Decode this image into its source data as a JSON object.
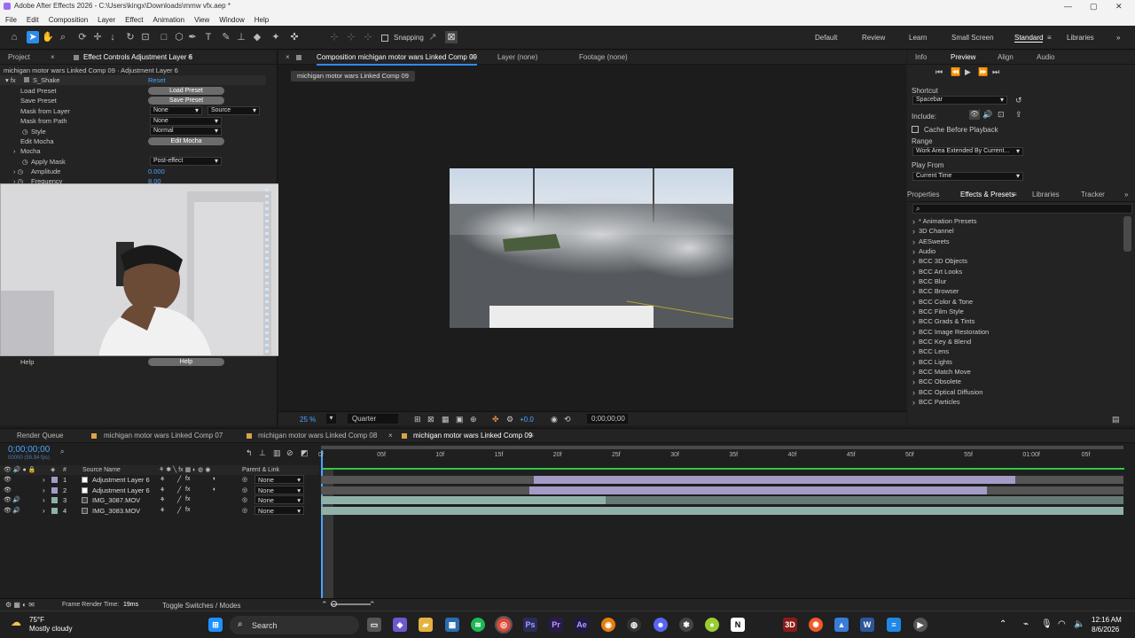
{
  "window": {
    "title": "Adobe After Effects 2026 - C:\\Users\\kingx\\Downloads\\mmw vfx.aep *"
  },
  "menu": [
    "File",
    "Edit",
    "Composition",
    "Layer",
    "Effect",
    "Animation",
    "View",
    "Window",
    "Help"
  ],
  "toolbar": {
    "snapping": "Snapping"
  },
  "workspaces": [
    "Default",
    "Review",
    "Learn",
    "Small Screen",
    "Standard",
    "Libraries"
  ],
  "left_panel": {
    "tabs": [
      "Project",
      "Effect Controls Adjustment Layer 6"
    ],
    "subtitle": "michigan motor wars Linked Comp 09 · Adjustment Layer 6",
    "effect_name": "S_Shake",
    "reset": "Reset",
    "props": [
      {
        "label": "Load Preset",
        "control": "Load Preset"
      },
      {
        "label": "Save Preset",
        "control": "Save Preset"
      },
      {
        "label": "Mask from Layer",
        "control": "None",
        "control2": "Source"
      },
      {
        "label": "Mask from Path",
        "control": "None"
      },
      {
        "label": "Style",
        "control": "Normal"
      },
      {
        "label": "Edit Mocha",
        "control": "Edit Mocha"
      },
      {
        "label": "Mocha",
        "control": ""
      },
      {
        "label": "Apply Mask",
        "control": "Post-effect"
      },
      {
        "label": "Amplitude",
        "control": "0.000"
      },
      {
        "label": "Frequency",
        "control": "8.00"
      }
    ],
    "help_label": "Help",
    "help_button": "Help"
  },
  "viewer": {
    "tabs": [
      "Composition michigan motor wars Linked Comp 09",
      "Layer (none)",
      "Footage (none)"
    ],
    "comp_chip": "michigan motor wars Linked Comp 09",
    "zoom": "25 %",
    "resolution": "Quarter",
    "exposure": "+0.0",
    "timecode": "0;00;00;00"
  },
  "preview_panel": {
    "tabs": [
      "Info",
      "Preview",
      "Align",
      "Audio"
    ],
    "shortcut_label": "Shortcut",
    "shortcut_value": "Spacebar",
    "include_label": "Include:",
    "cache_label": "Cache Before Playback",
    "range_label": "Range",
    "range_value": "Work Area Extended By Current...",
    "play_from_label": "Play From",
    "play_from_value": "Current Time"
  },
  "effects_panel": {
    "tabs": [
      "Properties",
      "Effects & Presets",
      "Libraries",
      "Tracker"
    ],
    "search_placeholder": "",
    "items": [
      "* Animation Presets",
      "3D Channel",
      "AESweets",
      "Audio",
      "BCC 3D Objects",
      "BCC Art Looks",
      "BCC Blur",
      "BCC Browser",
      "BCC Color & Tone",
      "BCC Film Style",
      "BCC Grads & Tints",
      "BCC Image Restoration",
      "BCC Key & Blend",
      "BCC Lens",
      "BCC Lights",
      "BCC Match Move",
      "BCC Obsolete",
      "BCC Optical Diffusion",
      "BCC Particles"
    ]
  },
  "timeline": {
    "tabs": [
      "Render Queue",
      "michigan motor wars Linked Comp 07",
      "michigan motor wars Linked Comp 08",
      "michigan motor wars Linked Comp 09"
    ],
    "timecode": "0;00;00;00",
    "timecode_sub": "00000 (59.94 fps)",
    "col_num": "#",
    "col_source": "Source Name",
    "col_parent": "Parent & Link",
    "layers": [
      {
        "num": "1",
        "name": "Adjustment Layer 6",
        "parent": "None",
        "color": "#a49bc7",
        "start": 0.265,
        "end": 0.865
      },
      {
        "num": "2",
        "name": "Adjustment Layer 6",
        "parent": "None",
        "color": "#a49bc7",
        "start": 0.26,
        "end": 0.83
      },
      {
        "num": "3",
        "name": "IMG_3087.MOV",
        "parent": "None",
        "color": "#8fb1a9",
        "start": 0.0,
        "end": 0.355
      },
      {
        "num": "4",
        "name": "IMG_3083.MOV",
        "parent": "None",
        "color": "#8fb1a9",
        "start": 0.0,
        "end": 1.0
      }
    ],
    "ruler": [
      "0f",
      "05f",
      "10f",
      "15f",
      "20f",
      "25f",
      "30f",
      "35f",
      "40f",
      "45f",
      "50f",
      "55f",
      "01:00f",
      "05f"
    ],
    "footer_left": "Frame Render Time:",
    "footer_time": "19ms",
    "toggle": "Toggle Switches / Modes"
  },
  "taskbar": {
    "weather_temp": "75°F",
    "weather_desc": "Mostly cloudy",
    "search": "Search",
    "time": "12:16 AM",
    "date": "8/6/2026"
  },
  "colors": {
    "accent": "#2d8ceb",
    "timeline_green": "#2ecc40",
    "adjustment": "#a49bc7",
    "footage": "#8fb1a9"
  }
}
